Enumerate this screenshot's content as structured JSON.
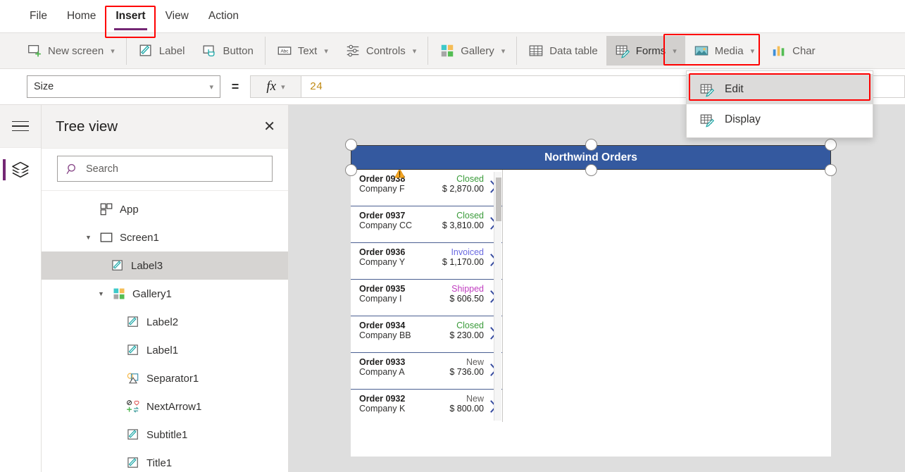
{
  "menubar": {
    "items": [
      {
        "label": "File",
        "active": false
      },
      {
        "label": "Home",
        "active": false
      },
      {
        "label": "Insert",
        "active": true
      },
      {
        "label": "View",
        "active": false
      },
      {
        "label": "Action",
        "active": false
      }
    ]
  },
  "ribbon": {
    "items": [
      {
        "label": "New screen",
        "icon": "new-screen-icon",
        "caret": true,
        "selected": false
      },
      {
        "label": "Label",
        "icon": "label-icon",
        "caret": false,
        "selected": false
      },
      {
        "label": "Button",
        "icon": "button-icon",
        "caret": false,
        "selected": false
      },
      {
        "label": "Text",
        "icon": "text-icon",
        "caret": true,
        "selected": false
      },
      {
        "label": "Controls",
        "icon": "controls-icon",
        "caret": true,
        "selected": false
      },
      {
        "label": "Gallery",
        "icon": "gallery-icon",
        "caret": true,
        "selected": false
      },
      {
        "label": "Data table",
        "icon": "data-table-icon",
        "caret": false,
        "selected": false
      },
      {
        "label": "Forms",
        "icon": "forms-icon",
        "caret": true,
        "selected": true
      },
      {
        "label": "Media",
        "icon": "media-icon",
        "caret": true,
        "selected": false
      },
      {
        "label": "Char",
        "icon": "charts-icon",
        "caret": false,
        "selected": false
      }
    ]
  },
  "forms_menu": {
    "items": [
      {
        "label": "Edit",
        "icon": "forms-icon",
        "highlighted": true
      },
      {
        "label": "Display",
        "icon": "forms-icon",
        "highlighted": false
      }
    ]
  },
  "formula_bar": {
    "property": "Size",
    "equals": "=",
    "fx_label": "fx",
    "value": "24",
    "value_color": "#c08a14"
  },
  "left_rail": {
    "hamburger": "hamburger-icon",
    "items": [
      {
        "name": "tree-view-layers",
        "icon": "layers-icon",
        "active": true
      }
    ]
  },
  "tree_panel": {
    "title": "Tree view",
    "close": "✕",
    "search_placeholder": "Search",
    "nodes": [
      {
        "label": "App",
        "icon": "app-icon",
        "indent": 0,
        "caret": "",
        "selected": false
      },
      {
        "label": "Screen1",
        "icon": "screen-icon",
        "indent": 0,
        "caret": "▴",
        "selected": false
      },
      {
        "label": "Label3",
        "icon": "label-icon",
        "indent": 1,
        "caret": "",
        "selected": true
      },
      {
        "label": "Gallery1",
        "icon": "gallery-icon",
        "indent": 1,
        "caret": "▴",
        "selected": false
      },
      {
        "label": "Label2",
        "icon": "label-icon",
        "indent": 2,
        "caret": "",
        "selected": false
      },
      {
        "label": "Label1",
        "icon": "label-icon",
        "indent": 2,
        "caret": "",
        "selected": false
      },
      {
        "label": "Separator1",
        "icon": "separator-icon",
        "indent": 2,
        "caret": "",
        "selected": false
      },
      {
        "label": "NextArrow1",
        "icon": "next-arrow-icon",
        "indent": 2,
        "caret": "",
        "selected": false
      },
      {
        "label": "Subtitle1",
        "icon": "label-icon",
        "indent": 2,
        "caret": "",
        "selected": false
      },
      {
        "label": "Title1",
        "icon": "label-icon",
        "indent": 2,
        "caret": "",
        "selected": false
      }
    ]
  },
  "canvas": {
    "app_header": {
      "title": "Northwind Orders",
      "background": "#34599f",
      "selected": true
    },
    "status_colors": {
      "Closed": "#3a9b3a",
      "Invoiced": "#6a6ae0",
      "Shipped": "#c03ec0",
      "New": "#605e5c"
    },
    "gallery_rows": [
      {
        "title": "Order 0938",
        "company": "Company F",
        "status": "Closed",
        "amount": "$ 2,870.00",
        "warning": true
      },
      {
        "title": "Order 0937",
        "company": "Company CC",
        "status": "Closed",
        "amount": "$ 3,810.00",
        "warning": false
      },
      {
        "title": "Order 0936",
        "company": "Company Y",
        "status": "Invoiced",
        "amount": "$ 1,170.00",
        "warning": false
      },
      {
        "title": "Order 0935",
        "company": "Company I",
        "status": "Shipped",
        "amount": "$ 606.50",
        "warning": false
      },
      {
        "title": "Order 0934",
        "company": "Company BB",
        "status": "Closed",
        "amount": "$ 230.00",
        "warning": false
      },
      {
        "title": "Order 0933",
        "company": "Company A",
        "status": "New",
        "amount": "$ 736.00",
        "warning": false
      },
      {
        "title": "Order 0932",
        "company": "Company K",
        "status": "New",
        "amount": "$ 800.00",
        "warning": false
      }
    ]
  }
}
